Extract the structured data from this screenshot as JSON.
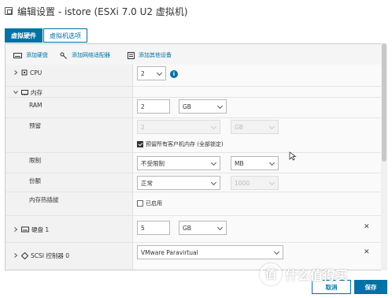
{
  "window": {
    "title": "编辑设置 - istore (ESXi 7.0 U2 虚拟机)"
  },
  "tabs": [
    {
      "label": "虚拟硬件",
      "active": true
    },
    {
      "label": "虚拟机选项",
      "active": false
    }
  ],
  "toolbar": {
    "add_disk": "添加硬盘",
    "add_nic": "添加网络适配器",
    "add_other": "添加其他设备"
  },
  "rows": {
    "cpu": {
      "label": "CPU",
      "value": "2"
    },
    "memory": {
      "label": "内存"
    },
    "ram": {
      "label": "RAM",
      "value": "2",
      "unit": "GB"
    },
    "reserve": {
      "label": "预留",
      "value": "2",
      "unit": "GB",
      "checkbox_label": "预留所有客户机内存 (全部锁定)",
      "checked": true
    },
    "limit": {
      "label": "限制",
      "value": "不受限制",
      "unit": "MB"
    },
    "shares": {
      "label": "份额",
      "value": "正常",
      "amount": "1000"
    },
    "hotplug": {
      "label": "内存热插拔",
      "checkbox_label": "已启用",
      "checked": false
    },
    "disk": {
      "label": "硬盘 1",
      "value": "5",
      "unit": "GB"
    },
    "scsi": {
      "label": "SCSI 控制器 0",
      "value": "VMware Paravirtual"
    }
  },
  "footer": {
    "cancel": "取消",
    "save": "保存"
  },
  "watermark": {
    "glyph": "值",
    "text": "什么值得买"
  },
  "colors": {
    "accent": "#0072a3"
  }
}
